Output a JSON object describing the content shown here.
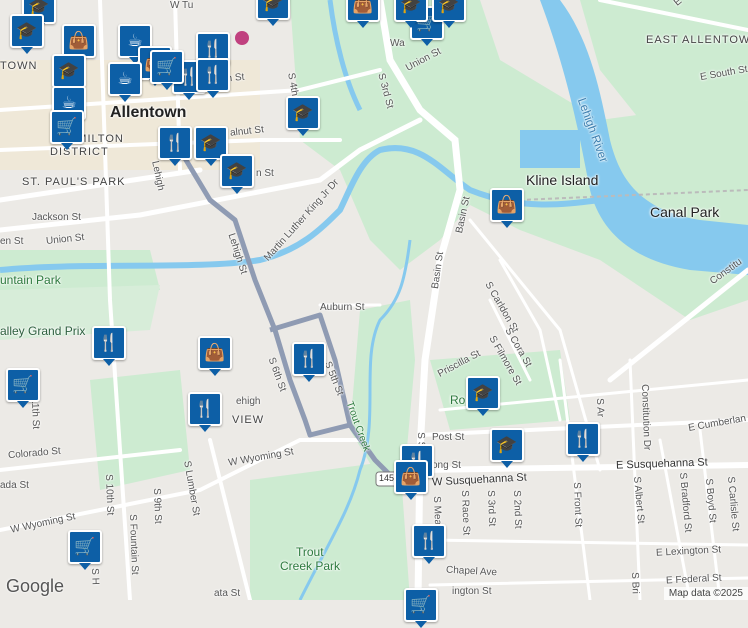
{
  "colors": {
    "land": "#eceae6",
    "park": "#cdebd1",
    "water": "#86c9ee",
    "road": "#ffffff",
    "highlight_route": "#8f9bb3",
    "pin": "#0d5fa6"
  },
  "labels": {
    "allentown": "Allentown",
    "east_allentown": "EAST ALLENTOWN",
    "hamilton_district": "HAMILTON",
    "district": "DISTRICT",
    "st_pauls_park": "ST. PAUL'S PARK",
    "town": "TOWN",
    "kline_island": "Kline Island",
    "canal_park": "Canal Park",
    "lehigh_river": "Lehigh River",
    "fountain_park": "untain Park",
    "valley_grand_prix": "alley Grand Prix",
    "trout_creek_park_1": "Trout",
    "trout_creek_park_2": "Creek Park",
    "trout_creek": "Trout Creek",
    "roosevelt_park": "Ro   t Park",
    "view": "VIEW",
    "w_tu": "W Tu",
    "s_3rd_st_top": "S 3rd St",
    "union_st_right": "Union St",
    "wa": "Wa",
    "hamilton_st": "amilton St",
    "s4th": "S 4th",
    "walnut_st": "alnut St",
    "n_st": "n St",
    "jackson_st": "Jackson St",
    "union_st_left": "Union St",
    "en_st": "en St",
    "mlk": "Martin Luther King Jr Dr",
    "basin_st_1": "Basin St",
    "basin_st_2": "Basin St",
    "lehigh_st_1": "Lehigh St",
    "lehigh_st_2": "Lehigh",
    "auburn_st": "Auburn St",
    "s6th": "S 6th St",
    "s5th": "S 5th St",
    "s_carlton": "S Carldon St",
    "s_cora": "S Cora St",
    "s_filmore": "S Filmore St",
    "priscilla": "Priscilla St",
    "post_st": "Post St",
    "w_susquehanna": "W Susquehanna St",
    "e_susquehanna": "E Susquehanna St",
    "e_cumberland": "E Cumberlan",
    "constitution_dr": "Constitution Dr",
    "constitution_right": "Constitu",
    "s_alber": "S Albert St",
    "s_bradford": "S Bradford St",
    "s_boyd": "S Boyd St",
    "s_carlisle": "S Carlisle St",
    "s_front": "S Front St",
    "s_2nd": "S 2nd St",
    "s_3rd_low": "S 3rd St",
    "s_race": "S Race St",
    "s_mea": "S Mea",
    "e_lexington": "E Lexington St",
    "e_federal": "E Federal St",
    "chapel_ave": "Chapel Ave",
    "ington_st": "ington St",
    "ata_st": "ata St",
    "w_wyoming_1": "W Wyoming St",
    "w_wyoming_2": "W Wyoming St",
    "colorado": "Colorado St",
    "ada_st": "ada St",
    "s10th": "S 10th St",
    "s9th": "S 9th St",
    "s_fountain": "S Fountain St",
    "s_lumber": "S Lumber St",
    "s11th": "11th St",
    "s_h": "S H",
    "ong_st": "ong St",
    "s_a_st": "S Ar",
    "s_bri": "S Bri",
    "e_u": "E U",
    "e_south_st": "E South St",
    "s_st_top": "S St",
    "shield_145": "145",
    "s_lehigh_mid": "ehigh"
  },
  "pins": [
    {
      "icon": "school",
      "label": "school"
    },
    {
      "icon": "school",
      "label": "school"
    },
    {
      "icon": "shopping",
      "label": "shopping"
    },
    {
      "icon": "coffee",
      "label": "coffee"
    },
    {
      "icon": "school",
      "label": "school"
    },
    {
      "icon": "restaurant",
      "label": "restaurant"
    },
    {
      "icon": "shopping",
      "label": "shopping"
    },
    {
      "icon": "restaurant",
      "label": "restaurant"
    },
    {
      "icon": "restaurant",
      "label": "restaurant"
    },
    {
      "icon": "coffee",
      "label": "coffee"
    },
    {
      "icon": "coffee",
      "label": "coffee"
    },
    {
      "icon": "shopping",
      "label": "shopping"
    },
    {
      "icon": "restaurant",
      "label": "restaurant"
    },
    {
      "icon": "school",
      "label": "school"
    },
    {
      "icon": "school",
      "label": "school"
    },
    {
      "icon": "school",
      "label": "school"
    },
    {
      "icon": "grocery",
      "label": "grocery"
    },
    {
      "icon": "school",
      "label": "school"
    },
    {
      "icon": "grocery",
      "label": "grocery"
    },
    {
      "icon": "school",
      "label": "school"
    },
    {
      "icon": "school",
      "label": "school"
    },
    {
      "icon": "shopping",
      "label": "shopping"
    },
    {
      "icon": "restaurant",
      "label": "restaurant"
    },
    {
      "icon": "shopping",
      "label": "shopping"
    },
    {
      "icon": "restaurant",
      "label": "restaurant"
    },
    {
      "icon": "grocery",
      "label": "grocery"
    },
    {
      "icon": "restaurant",
      "label": "restaurant"
    },
    {
      "icon": "school",
      "label": "school"
    },
    {
      "icon": "school",
      "label": "school"
    },
    {
      "icon": "restaurant",
      "label": "restaurant"
    },
    {
      "icon": "restaurant",
      "label": "restaurant"
    },
    {
      "icon": "shopping",
      "label": "shopping"
    },
    {
      "icon": "restaurant",
      "label": "restaurant"
    },
    {
      "icon": "grocery",
      "label": "grocery"
    },
    {
      "icon": "grocery",
      "label": "grocery"
    },
    {
      "icon": "grocery",
      "label": "grocery"
    }
  ],
  "icons": {
    "school": "🎓",
    "shopping": "👜",
    "grocery": "🛒",
    "coffee": "☕",
    "restaurant": "🍴"
  },
  "footer": {
    "logo": "Google",
    "attribution": "Map data ©2025"
  }
}
